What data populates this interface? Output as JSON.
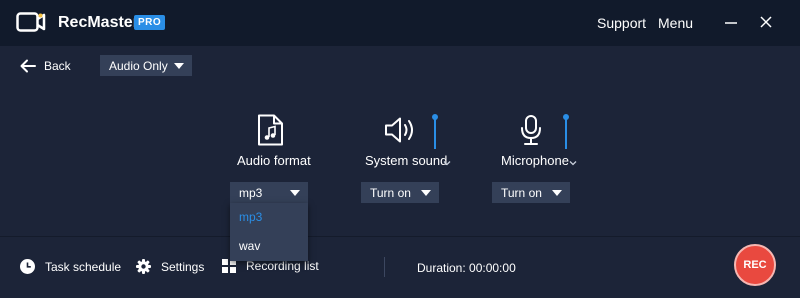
{
  "app": {
    "name": "RecMaster",
    "badge": "PRO"
  },
  "titlebar": {
    "support": "Support",
    "menu": "Menu"
  },
  "nav": {
    "back_label": "Back",
    "mode_value": "Audio Only"
  },
  "controls": {
    "audio_format": {
      "label": "Audio format",
      "value": "mp3"
    },
    "system_sound": {
      "label": "System sound",
      "value": "Turn on"
    },
    "microphone": {
      "label": "Microphone",
      "value": "Turn on"
    }
  },
  "format_dropdown": {
    "options": [
      "mp3",
      "wav"
    ],
    "selected": "mp3"
  },
  "bottom": {
    "task_schedule": "Task schedule",
    "settings": "Settings",
    "recording_list": "Recording list",
    "duration": "Duration: 00:00:00",
    "rec": "REC"
  },
  "colors": {
    "accent": "#2a8ee6",
    "background": "#1c2438",
    "titlebar": "#111a2b",
    "rec": "#e9493f",
    "select": "#344058"
  }
}
